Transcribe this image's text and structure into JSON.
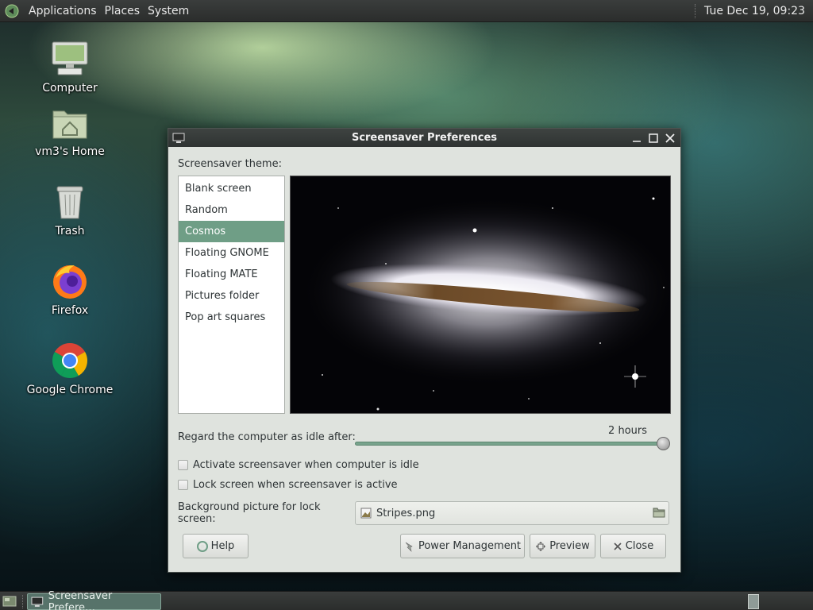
{
  "top_panel": {
    "menus": [
      "Applications",
      "Places",
      "System"
    ],
    "clock": "Tue Dec 19, 09:23"
  },
  "desktop": {
    "icons": [
      {
        "label": "Computer",
        "icon": "computer-icon"
      },
      {
        "label": "vm3's Home",
        "icon": "home-folder-icon"
      },
      {
        "label": "Trash",
        "icon": "trash-icon"
      },
      {
        "label": "Firefox",
        "icon": "firefox-icon"
      },
      {
        "label": "Google Chrome",
        "icon": "chrome-icon"
      }
    ]
  },
  "window": {
    "title": "Screensaver Preferences",
    "theme_label": "Screensaver theme:",
    "themes": [
      "Blank screen",
      "Random",
      "Cosmos",
      "Floating GNOME",
      "Floating MATE",
      "Pictures folder",
      "Pop art squares"
    ],
    "selected_theme": "Cosmos",
    "idle_label": "Regard the computer as idle after:",
    "idle_value": "2 hours",
    "idle_level_percent": 100,
    "activate_label": "Activate screensaver when computer is idle",
    "activate_checked": false,
    "lock_label": "Lock screen when screensaver is active",
    "lock_checked": false,
    "bg_label": "Background picture for lock screen:",
    "bg_file": "Stripes.png",
    "buttons": {
      "help": "Help",
      "power": "Power Management",
      "preview": "Preview",
      "close": "Close"
    }
  },
  "taskbar": {
    "task_label": "Screensaver Prefere…"
  },
  "colors": {
    "selection": "#6f9e86",
    "slider": "#77a38c",
    "panel": "#2f3231"
  }
}
